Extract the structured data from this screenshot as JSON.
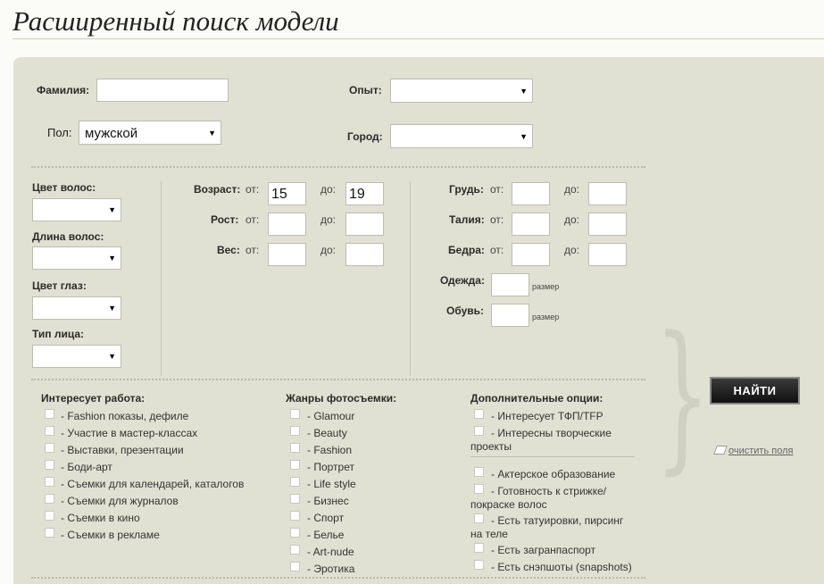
{
  "page": {
    "title": "Расширенный поиск модели"
  },
  "form": {
    "surname_label": "Фамилия:",
    "surname_value": "",
    "experience_label": "Опыт:",
    "experience_value": "",
    "gender_label": "Пол:",
    "gender_value": "мужской",
    "city_label": "Город:",
    "city_value": "",
    "hair_color_label": "Цвет волос:",
    "hair_length_label": "Длина волос:",
    "eye_color_label": "Цвет глаз:",
    "face_type_label": "Тип лица:",
    "from": "от:",
    "to": "до:",
    "age_label": "Возраст:",
    "age_from": "15",
    "age_to": "19",
    "height_label": "Рост:",
    "weight_label": "Вес:",
    "chest_label": "Грудь:",
    "waist_label": "Талия:",
    "hips_label": "Бедра:",
    "clothes_label": "Одежда:",
    "shoes_label": "Обувь:",
    "size_label": "размер"
  },
  "work": {
    "title": "Интересует работа:",
    "items": [
      "- Fashion показы, дефиле",
      "- Участие в мастер-классах",
      "- Выставки, презентации",
      "- Боди-арт",
      "- Съемки для календарей, каталогов",
      "- Съемки для журналов",
      "- Съемки в кино",
      "- Съемки в рекламе"
    ]
  },
  "genres": {
    "title": "Жанры фотосъемки:",
    "items": [
      "- Glamour",
      "- Beauty",
      "- Fashion",
      "- Портрет",
      "- Life style",
      "- Бизнес",
      "- Спорт",
      "- Белье",
      "- Art-nude",
      "- Эротика"
    ]
  },
  "options": {
    "title": "Дополнительные опции:",
    "items": [
      [
        "- Интересует ТФП/TFP"
      ],
      [
        "- Интересны творческие",
        "проекты"
      ],
      [
        "- Актерское образование"
      ],
      [
        "- Готовность к стрижке/",
        "покраске волос"
      ],
      [
        "- Есть татуировки, пирсинг",
        "на теле"
      ],
      [
        "- Есть загранпаспорт"
      ],
      [
        "- Есть снэпшоты (snapshots)"
      ]
    ]
  },
  "actions": {
    "search": "НАЙТИ",
    "clear": "очистить поля"
  }
}
